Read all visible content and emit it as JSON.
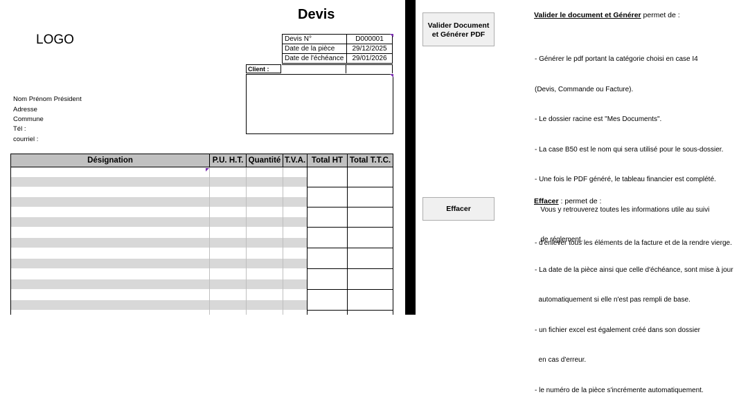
{
  "document": {
    "title": "Devis",
    "logo": "LOGO",
    "info": [
      {
        "label": "Devis N°",
        "value": "D000001"
      },
      {
        "label": "Date de la pièce",
        "value": "29/12/2025"
      },
      {
        "label": "Date de l'échéance",
        "value": "29/01/2026"
      }
    ],
    "client_label": "Client :",
    "address_lines": [
      "Nom Prénom Président",
      "Adresse",
      "Commune",
      "Tél :",
      "courriel :"
    ],
    "table_headers": [
      "Désignation",
      "P.U.  H.T.",
      "Quantité",
      "T.V.A.",
      "Total HT",
      "Total T.T.C."
    ]
  },
  "panel": {
    "valider_button": "Valider Document\net Générer PDF",
    "valider_title_bold": "Valider le document et Générer",
    "valider_title_rest": " permet de :",
    "valider_bullets": [
      "- Générer le pdf portant la catégorie choisi en case I4",
      "(Devis, Commande ou Facture).",
      "- Le dossier racine est \"Mes Documents\".",
      "- La case B50 est le nom qui sera utilisé pour le sous-dossier.",
      "- Une fois le PDF généré, le tableau financier est complété.",
      "   Vous y retrouverez toutes les informations utile au suivi",
      "   de réglement.",
      "- La date de la pièce ainsi que celle d'échéance, sont mise à jour",
      "  automatiquement si elle n'est pas rempli de base.",
      "- un fichier excel est également créé dans son dossier",
      "  en cas d'erreur.",
      "- le numéro de la pièce s'incrémente automatiquement."
    ],
    "effacer_button": "Effacer",
    "effacer_title_bold": "Effacer",
    "effacer_title_rest": " : permet de :",
    "effacer_bullets": [
      "- d'enlever tous les éléments de la facture et de la rendre vierge."
    ]
  },
  "colors": {
    "header_fill": "#c0c0c0",
    "band_fill": "#d8d8d8",
    "comment_marker": "#7b2fb0"
  }
}
